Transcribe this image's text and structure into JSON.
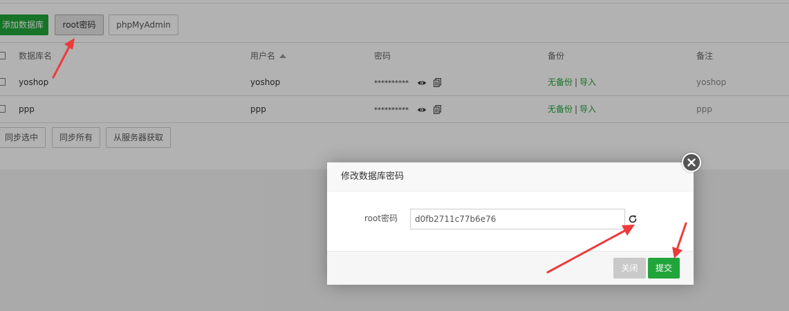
{
  "toolbar": {
    "add_db": "添加数据库",
    "root_password": "root密码",
    "phpmyadmin": "phpMyAdmin"
  },
  "table": {
    "headers": {
      "name": "数据库名",
      "user": "用户名",
      "password": "密码",
      "backup": "备份",
      "note": "备注"
    },
    "rows": [
      {
        "name": "yoshop",
        "user": "yoshop",
        "password": "**********",
        "backup": "无备份",
        "import": "导入",
        "note": "yoshop"
      },
      {
        "name": "ppp",
        "user": "ppp",
        "password": "**********",
        "backup": "无备份",
        "import": "导入",
        "note": "ppp"
      }
    ],
    "backup_separator": "|"
  },
  "actions": {
    "sync_selected": "同步选中",
    "sync_all": "同步所有",
    "fetch_from_server": "从服务器获取"
  },
  "dialog": {
    "title": "修改数据库密码",
    "field_label": "root密码",
    "field_value": "d0fb2711c77b6e76",
    "close_label": "关闭",
    "submit_label": "提交"
  },
  "colors": {
    "accent": "#20a53a",
    "annotation": "#ee3a3a"
  },
  "icons": {
    "view_password": "eye-icon",
    "copy_password": "copy-icon",
    "regenerate": "refresh-icon",
    "close_dialog": "close-icon"
  }
}
